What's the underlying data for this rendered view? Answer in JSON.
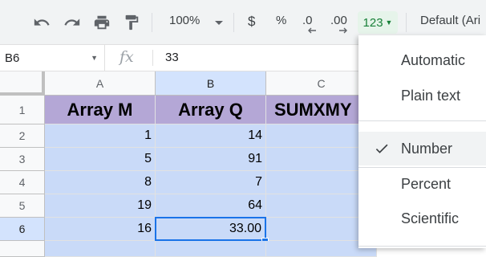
{
  "toolbar": {
    "zoom": "100%",
    "currency": "$",
    "percent": "%",
    "decrease_decimal": ".0",
    "increase_decimal": ".00",
    "more_formats": "123",
    "font": "Default (Ari"
  },
  "formula_bar": {
    "name_box": "B6",
    "fx": "fx",
    "value": "33"
  },
  "grid": {
    "columns": [
      "A",
      "B",
      "C"
    ],
    "rows": [
      "1",
      "2",
      "3",
      "4",
      "5",
      "6"
    ],
    "headers": [
      "Array M",
      "Array Q",
      "SUMXMY"
    ],
    "array_m": [
      "1",
      "5",
      "8",
      "19",
      "16"
    ],
    "array_q": [
      "14",
      "91",
      "7",
      "64",
      "33.00"
    ]
  },
  "menu": {
    "items": [
      "Automatic",
      "Plain text",
      "Number",
      "Percent",
      "Scientific"
    ],
    "selected": "Number"
  }
}
